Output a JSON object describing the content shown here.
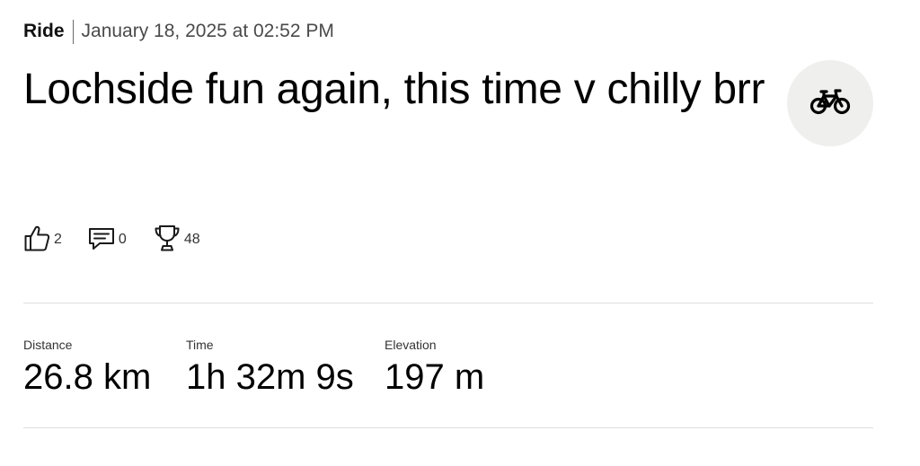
{
  "activity": {
    "type": "Ride",
    "date": "January 18, 2025 at 02:52 PM",
    "title": "Lochside fun again, this time v chilly brr",
    "sport_icon": "bike-icon"
  },
  "social": {
    "kudos": {
      "icon": "thumbs-up-icon",
      "count": "2"
    },
    "comments": {
      "icon": "comment-icon",
      "count": "0"
    },
    "achievements": {
      "icon": "trophy-icon",
      "count": "48"
    }
  },
  "stats": [
    {
      "label": "Distance",
      "value": "26.8 km"
    },
    {
      "label": "Time",
      "value": "1h 32m 9s"
    },
    {
      "label": "Elevation",
      "value": "197 m"
    }
  ],
  "colors": {
    "badge_background": "#efefed",
    "divider": "#dedede",
    "secondary_text": "#4a4a4a"
  }
}
